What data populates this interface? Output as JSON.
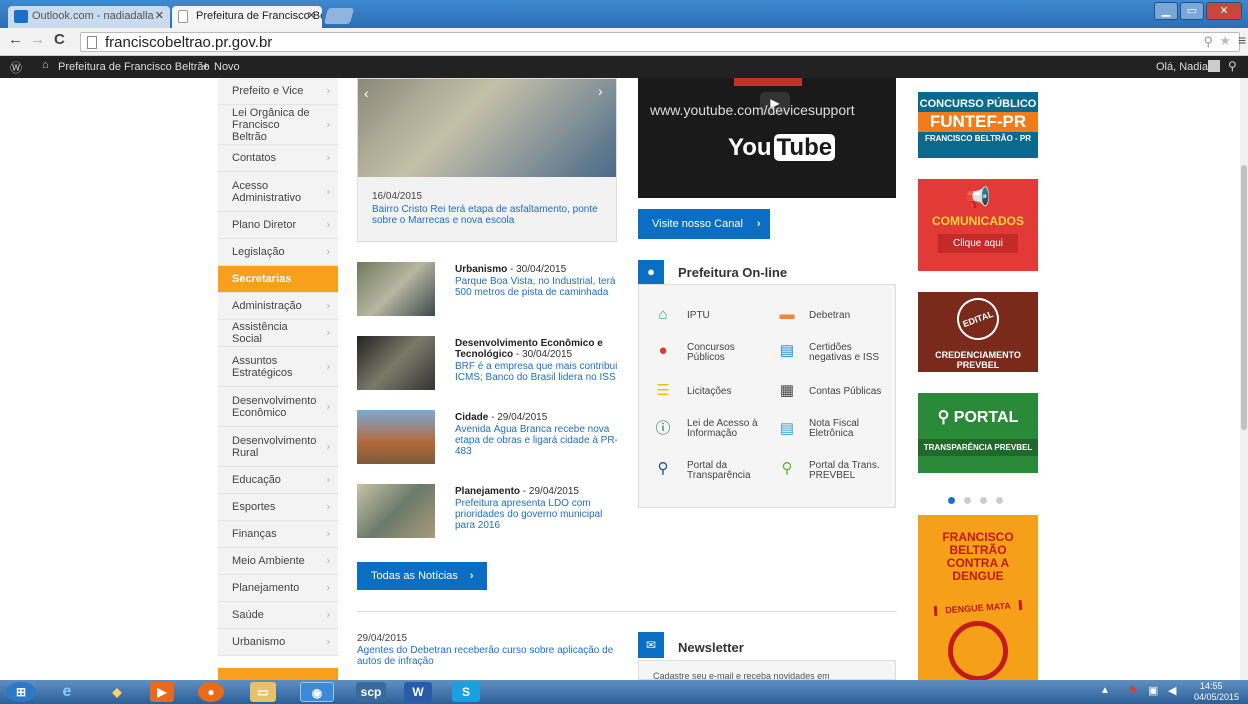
{
  "browser": {
    "tabs": [
      {
        "label": "Outlook.com - nadiadalla"
      },
      {
        "label": "Prefeitura de Francisco Be"
      }
    ],
    "url": "franciscobeltrao.pr.gov.br"
  },
  "adminbar": {
    "site": "Prefeitura de Francisco Beltrão",
    "new": "Novo",
    "greeting": "Olá, Nadia"
  },
  "sidebar": {
    "items": [
      {
        "label": "Prefeito e Vice"
      },
      {
        "label": "Lei Orgânica de Francisco Beltrão"
      },
      {
        "label": "Contatos"
      },
      {
        "label": "Acesso Administrativo"
      },
      {
        "label": "Plano Diretor"
      },
      {
        "label": "Legislação"
      },
      {
        "label": "Secretarias"
      },
      {
        "label": "Administração"
      },
      {
        "label": "Assistência Social"
      },
      {
        "label": "Assuntos Estratégicos"
      },
      {
        "label": "Desenvolvimento Econômico"
      },
      {
        "label": "Desenvolvimento Rural"
      },
      {
        "label": "Educação"
      },
      {
        "label": "Esportes"
      },
      {
        "label": "Finanças"
      },
      {
        "label": "Meio Ambiente"
      },
      {
        "label": "Planejamento"
      },
      {
        "label": "Saúde"
      },
      {
        "label": "Urbanismo"
      }
    ]
  },
  "featured": {
    "date": "16/04/2015",
    "title": "Bairro Cristo Rei terá etapa de asfaltamento, ponte sobre o Marrecas e nova escola"
  },
  "news": [
    {
      "cat": "Urbanismo",
      "date": " - 30/04/2015",
      "title": "Parque Boa Vista, no Industrial, terá 500 metros de pista de caminhada"
    },
    {
      "cat": "Desenvolvimento Econômico e Tecnológico",
      "date": " - 30/04/2015",
      "title": "BRF é a empresa que mais contribui ICMS; Banco do Brasil lidera no ISS"
    },
    {
      "cat": "Cidade",
      "date": " - 29/04/2015",
      "title": "Avenida Água Branca recebe nova etapa de obras e ligará cidade à PR-483"
    },
    {
      "cat": "Planejamento",
      "date": " - 29/04/2015",
      "title": "Prefeitura apresenta LDO com prioridades do governo municipal para 2016"
    }
  ],
  "all_news_btn": "Todas as Notícias",
  "bottom_news": {
    "date": "29/04/2015",
    "title": "Agentes do Debetran receberão curso sobre aplicação de autos de infração"
  },
  "video": {
    "url": "www.youtube.com/devicesupport",
    "logo_you": "You",
    "logo_tube": "Tube"
  },
  "channel_btn": "Visite nosso Canal",
  "online": {
    "title": "Prefeitura On-line",
    "items": [
      {
        "label": "IPTU"
      },
      {
        "label": "Debetran"
      },
      {
        "label": "Concursos Públicos"
      },
      {
        "label": "Certidões negativas e ISS"
      },
      {
        "label": "Licitações"
      },
      {
        "label": "Contas Públicas"
      },
      {
        "label": "Lei de Acesso à Informação"
      },
      {
        "label": "Nota Fiscal Eletrônica"
      },
      {
        "label": "Portal da Transparência"
      },
      {
        "label": "Portal da Trans. PREVBEL"
      }
    ]
  },
  "newsletter": {
    "title": "Newsletter",
    "text": "Cadastre seu e-mail e receba novidades em"
  },
  "banners": {
    "concurso": {
      "l1": "CONCURSO PÚBLICO",
      "l2": "FUNTEF-PR",
      "l3": "FRANCISCO BELTRÃO - PR"
    },
    "comunicados": {
      "title": "COMUNICADOS",
      "btn": "Clique aqui"
    },
    "edital": {
      "stamp": "EDITAL",
      "text": "CREDENCIAMENTO PREVBEL"
    },
    "portal": {
      "title": "PORTAL",
      "sub": "TRANSPARÊNCIA PREVBEL"
    },
    "dengue": {
      "text": "FRANCISCO BELTRÃO CONTRA A DENGUE",
      "mata": "DENGUE MATA"
    }
  },
  "taskbar": {
    "time": "14:55",
    "date": "04/05/2015"
  }
}
